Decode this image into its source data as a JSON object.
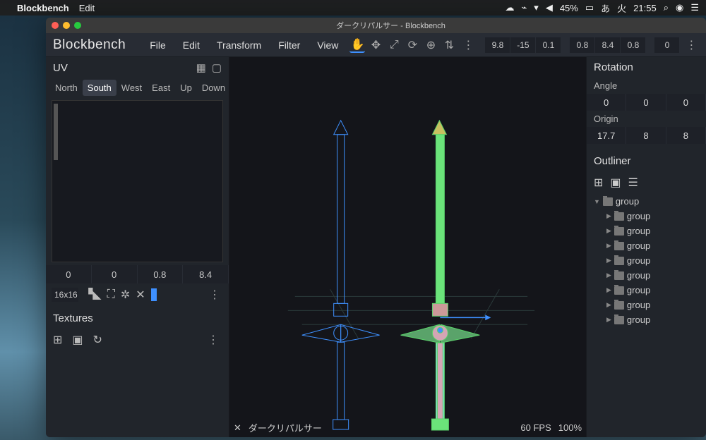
{
  "mac": {
    "app": "Blockbench",
    "edit": "Edit",
    "status": {
      "battery": "45%",
      "ime": "あ",
      "day": "火",
      "time": "21:55"
    }
  },
  "window": {
    "title": "ダークリパルサー - Blockbench"
  },
  "brand": "Blockbench",
  "menus": {
    "file": "File",
    "edit": "Edit",
    "transform": "Transform",
    "filter": "Filter",
    "view": "View"
  },
  "coords1": [
    "9.8",
    "-15",
    "0.1"
  ],
  "coords2": [
    "0.8",
    "8.4",
    "0.8"
  ],
  "coords3": [
    "0"
  ],
  "uv": {
    "title": "UV",
    "tabs": [
      "North",
      "South",
      "West",
      "East",
      "Up",
      "Down"
    ],
    "active": "South",
    "inputs": [
      "0",
      "0",
      "0.8",
      "8.4"
    ],
    "size": "16x16"
  },
  "textures": {
    "title": "Textures"
  },
  "rotation": {
    "title": "Rotation",
    "angle_label": "Angle",
    "angle": [
      "0",
      "0",
      "0"
    ],
    "origin_label": "Origin",
    "origin": [
      "17.7",
      "8",
      "8"
    ]
  },
  "outliner": {
    "title": "Outliner",
    "root": "group",
    "children": [
      "group",
      "group",
      "group",
      "group",
      "group",
      "group",
      "group",
      "group"
    ]
  },
  "status": {
    "file": "ダークリパルサー",
    "fps": "60 FPS",
    "zoom": "100%"
  }
}
